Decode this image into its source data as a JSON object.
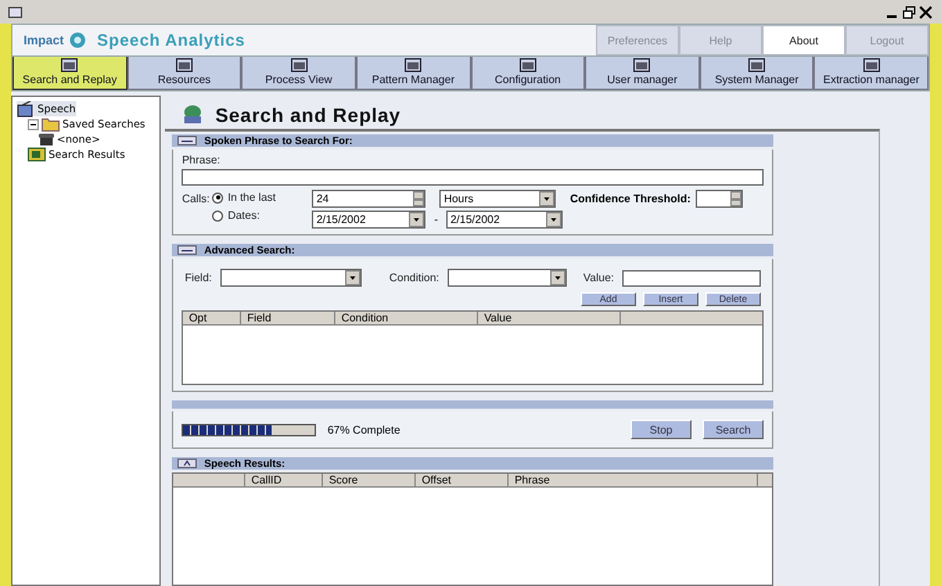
{
  "header": {
    "brand": "Impact",
    "product": "Speech Analytics",
    "buttons": [
      {
        "label": "Preferences",
        "selected": false
      },
      {
        "label": "Help",
        "selected": false
      },
      {
        "label": "About",
        "selected": true
      },
      {
        "label": "Logout",
        "selected": false
      }
    ]
  },
  "toolbar": [
    {
      "label": "Search and Replay",
      "selected": true
    },
    {
      "label": "Resources",
      "selected": false
    },
    {
      "label": "Process View",
      "selected": false
    },
    {
      "label": "Pattern Manager",
      "selected": false
    },
    {
      "label": "Configuration",
      "selected": false
    },
    {
      "label": "User manager",
      "selected": false
    },
    {
      "label": "System Manager",
      "selected": false
    },
    {
      "label": "Extraction manager",
      "selected": false
    }
  ],
  "tree": [
    {
      "label": "Speech",
      "selected": true,
      "children": [
        {
          "label": "Saved Searches",
          "expanded": true,
          "children": [
            {
              "label": "<none>",
              "selected": false
            }
          ]
        },
        {
          "label": "Search Results",
          "selected": false
        }
      ]
    }
  ],
  "page_title": "Search and Replay",
  "phrase_section": {
    "title": "Spoken Phrase to Search For:",
    "phrase_label": "Phrase:",
    "calls_label": "Calls:",
    "options": [
      {
        "label": "In the last",
        "selected": true
      },
      {
        "label": "Dates:",
        "selected": false
      }
    ],
    "amount": "24",
    "unit": "Hours",
    "date_from": "2/15/2002",
    "date_sep": "-",
    "date_to": "2/15/2002",
    "threshold_label": "Confidence Threshold:"
  },
  "advanced_section": {
    "title": "Advanced Search:",
    "field_label": "Field:",
    "condition_label": "Condition:",
    "value_label": "Value:",
    "buttons": [
      "Add",
      "Insert",
      "Delete"
    ],
    "columns": [
      "Opt",
      "Field",
      "Condition",
      "Value"
    ]
  },
  "progress": {
    "level": 0.67,
    "reading": "67% Complete",
    "buttons": [
      "Stop",
      "Search"
    ]
  },
  "results": {
    "title": "Speech Results:",
    "columns": [
      "",
      "CallID",
      "Score",
      "Offset",
      "Phrase"
    ]
  }
}
